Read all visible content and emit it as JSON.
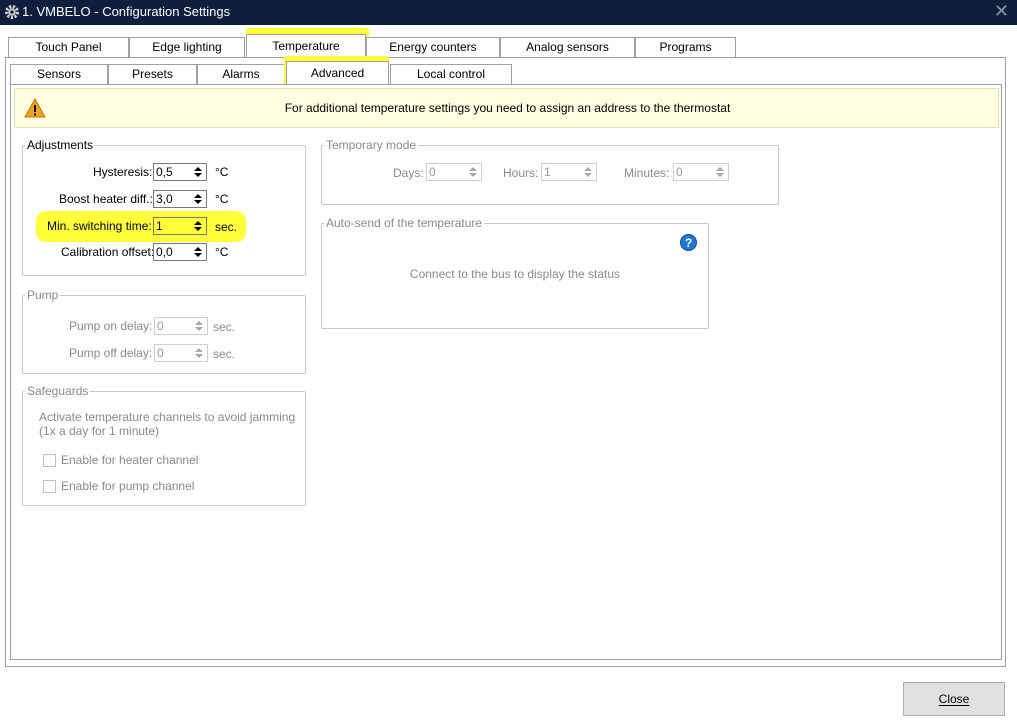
{
  "window": {
    "title": "1. VMBELO - Configuration Settings",
    "settings_icon": "gear-icon",
    "close_glyph": "✕"
  },
  "top_tabs": [
    "Touch Panel",
    "Edge lighting",
    "Temperature",
    "Energy counters",
    "Analog sensors",
    "Programs"
  ],
  "top_tabs_active": "Temperature",
  "sub_tabs": [
    "Sensors",
    "Presets",
    "Alarms",
    "Advanced",
    "Local control"
  ],
  "sub_tabs_active": "Advanced",
  "warning": {
    "icon": "warning-icon",
    "text": "For additional temperature settings you need to assign an address to the thermostat"
  },
  "adjustments": {
    "title": "Adjustments",
    "hysteresis": {
      "label": "Hysteresis:",
      "value": "0,5",
      "unit": "°C"
    },
    "boost": {
      "label": "Boost heater diff.:",
      "value": "3,0",
      "unit": "°C"
    },
    "min_switch": {
      "label": "Min. switching time:",
      "value": "1",
      "unit": "sec."
    },
    "calibration": {
      "label": "Calibration offset:",
      "value": "0,0",
      "unit": "°C"
    }
  },
  "pump": {
    "title": "Pump",
    "on_delay": {
      "label": "Pump on delay:",
      "value": "0",
      "unit": "sec."
    },
    "off_delay": {
      "label": "Pump off delay:",
      "value": "0",
      "unit": "sec."
    }
  },
  "safeguards": {
    "title": "Safeguards",
    "description_line1": "Activate temperature channels to avoid jamming",
    "description_line2": "(1x a day for 1 minute)",
    "heater_label": "Enable for heater channel",
    "pump_label": "Enable for pump channel"
  },
  "temporary_mode": {
    "title": "Temporary mode",
    "days": {
      "label": "Days:",
      "value": "0"
    },
    "hours": {
      "label": "Hours:",
      "value": "1"
    },
    "minutes": {
      "label": "Minutes:",
      "value": "0"
    }
  },
  "autosend": {
    "title": "Auto-send of the temperature",
    "status": "Connect to the bus to display the status",
    "help_icon": "help-icon"
  },
  "buttons": {
    "close": "Close"
  },
  "colors": {
    "titlebar": "#0e1f3d",
    "highlight": "#ffff3a",
    "warning_bg": "#ffffe1",
    "help_blue": "#1e78d2"
  }
}
